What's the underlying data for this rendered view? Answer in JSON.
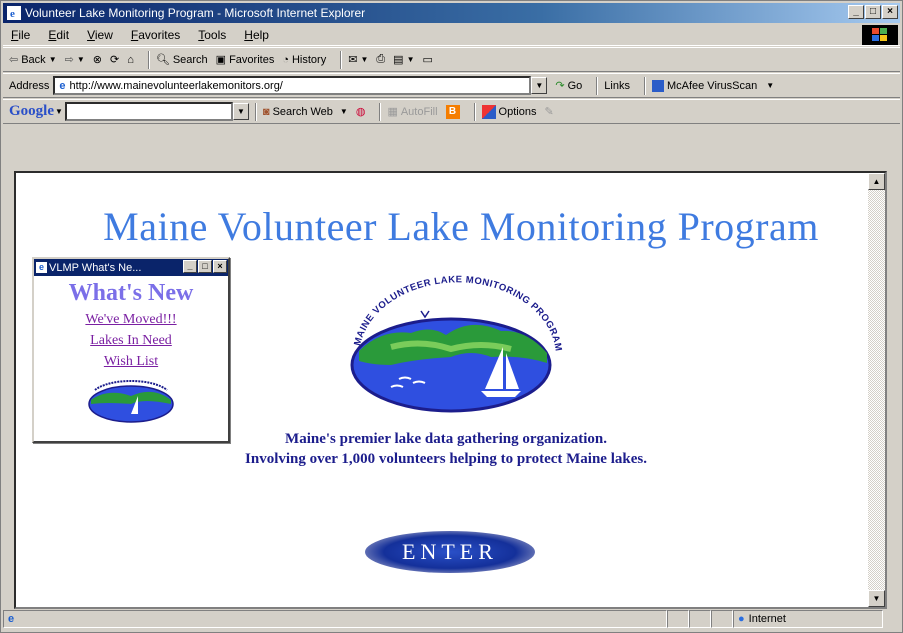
{
  "window": {
    "title": "Volunteer Lake Monitoring Program - Microsoft Internet Explorer",
    "controls": [
      "_",
      "□",
      "×"
    ]
  },
  "menu": [
    "File",
    "Edit",
    "View",
    "Favorites",
    "Tools",
    "Help"
  ],
  "toolbar": {
    "back": "Back",
    "search": "Search",
    "favorites": "Favorites",
    "history": "History"
  },
  "address": {
    "label": "Address",
    "url": "http://www.mainevolunteerlakemonitors.org/",
    "go": "Go",
    "links": "Links",
    "mcafee": "McAfee VirusScan"
  },
  "google_bar": {
    "logo": "Google",
    "search_web": "Search Web",
    "autofill": "AutoFill",
    "options": "Options"
  },
  "page": {
    "title": "Maine Volunteer Lake Monitoring Program",
    "logo_text": "MAINE VOLUNTEER LAKE MONITORING PROGRAM",
    "tagline1": "Maine's premier lake data gathering organization.",
    "tagline2": "Involving over 1,000 volunteers helping to protect Maine lakes.",
    "enter": "ENTER"
  },
  "popup": {
    "title": "VLMP What's Ne...",
    "heading": "What's New",
    "links": [
      "We've Moved!!!",
      "Lakes In Need",
      "Wish List"
    ]
  },
  "status": {
    "zone": "Internet"
  },
  "colors": {
    "title_bar": "#0a246a",
    "page_title": "#3f7be0",
    "tagline": "#1c1d8c",
    "link": "#7a1fa2",
    "whats_new": "#7b6fe8"
  }
}
